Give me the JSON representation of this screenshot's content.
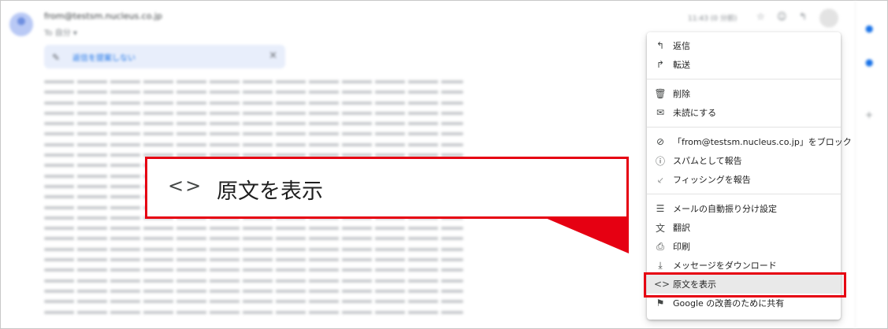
{
  "email": {
    "sender": "from@testsm.nucleus.co.jp",
    "to_line": "To 自分 ▾",
    "date": "11:43 (0 分前)",
    "banner_text": "返信を提案しない"
  },
  "menu": {
    "groups": [
      [
        {
          "icon": "reply-icon",
          "glyph": "↰",
          "label": "返信"
        },
        {
          "icon": "forward-icon",
          "glyph": "↱",
          "label": "転送"
        }
      ],
      [
        {
          "icon": "trash-icon",
          "glyph": "🗑",
          "label": "削除"
        },
        {
          "icon": "mark-unread-icon",
          "glyph": "✉",
          "label": "未読にする"
        }
      ],
      [
        {
          "icon": "block-icon",
          "glyph": "⊘",
          "label": "「from@testsm.nucleus.co.jp」をブロック"
        },
        {
          "icon": "report-spam-icon",
          "glyph": "ⓘ",
          "label": "スパムとして報告"
        },
        {
          "icon": "phishing-hook-icon",
          "glyph": "⸔",
          "label": "フィッシングを報告"
        }
      ],
      [
        {
          "icon": "filter-icon",
          "glyph": "☰",
          "label": "メールの自動振り分け設定"
        },
        {
          "icon": "translate-icon",
          "glyph": "文",
          "label": "翻訳"
        },
        {
          "icon": "print-icon",
          "glyph": "⎙",
          "label": "印刷"
        },
        {
          "icon": "download-icon",
          "glyph": "⤓",
          "label": "メッセージをダウンロード"
        },
        {
          "icon": "code-icon",
          "glyph": "<>",
          "label": "原文を表示",
          "selected": true
        },
        {
          "icon": "feedback-icon",
          "glyph": "⚑",
          "label": "Google の改善のために共有"
        }
      ]
    ]
  },
  "callout": {
    "icon": "code-icon",
    "glyph": "<>",
    "label": "原文を表示"
  },
  "colors": {
    "highlight": "#e60012",
    "selected_bg": "#e9e9e9",
    "accent": "#1a73e8"
  }
}
